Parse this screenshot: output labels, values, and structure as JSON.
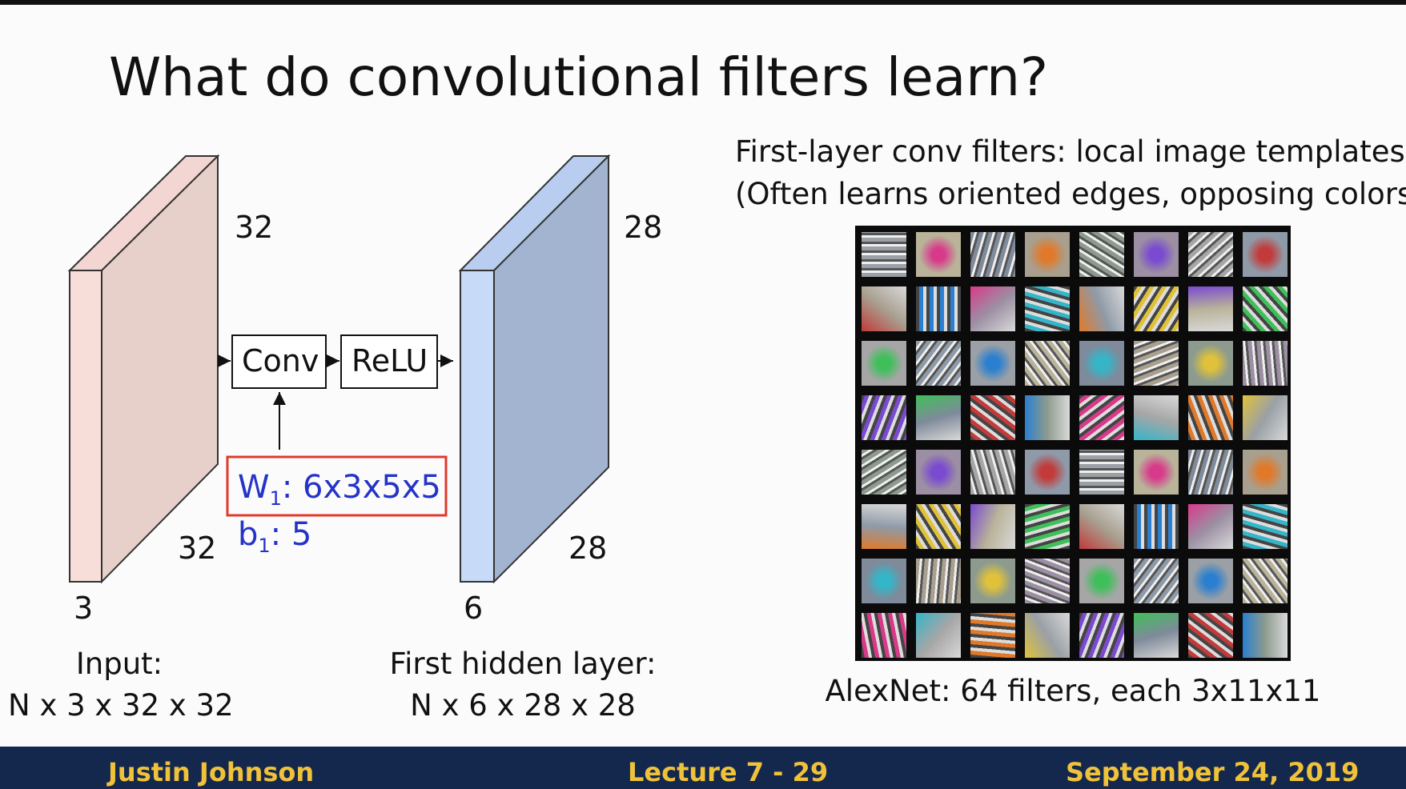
{
  "slide": {
    "title": "What do convolutional filters learn?",
    "input_block": {
      "height_label": "32",
      "width_label": "32",
      "depth_label": "3",
      "caption_line1": "Input:",
      "caption_line2": "N x 3 x 32 x 32",
      "front_color": "#f8ded9",
      "side_color": "#e7cfca"
    },
    "ops": {
      "conv_label": "Conv",
      "relu_label": "ReLU"
    },
    "weights": {
      "w_label": "W",
      "w_sub": "1",
      "w_value": ": 6x3x5x5",
      "b_label": "b",
      "b_sub": "1",
      "b_value": ": 5",
      "text_color": "#2433c8",
      "box_color": "#e03a2e"
    },
    "hidden_block": {
      "height_label": "28",
      "width_label": "28",
      "depth_label": "6",
      "caption_line1": "First hidden layer:",
      "caption_line2": "N x 6 x 28 x 28",
      "front_color": "#c7daf7",
      "side_color": "#a2b4d0"
    },
    "filters_panel": {
      "heading_line1": "First-layer conv filters: local image templates",
      "heading_line2": "(Often learns oriented edges, opposing colors)",
      "caption": "AlexNet: 64 filters, each 3x11x11",
      "grid_rows": 8,
      "grid_cols": 8
    }
  },
  "footer": {
    "author": "Justin Johnson",
    "lecture": "Lecture 7 - 29",
    "date": "September 24, 2019",
    "background": "#14284d",
    "text_color": "#f0c23a"
  }
}
